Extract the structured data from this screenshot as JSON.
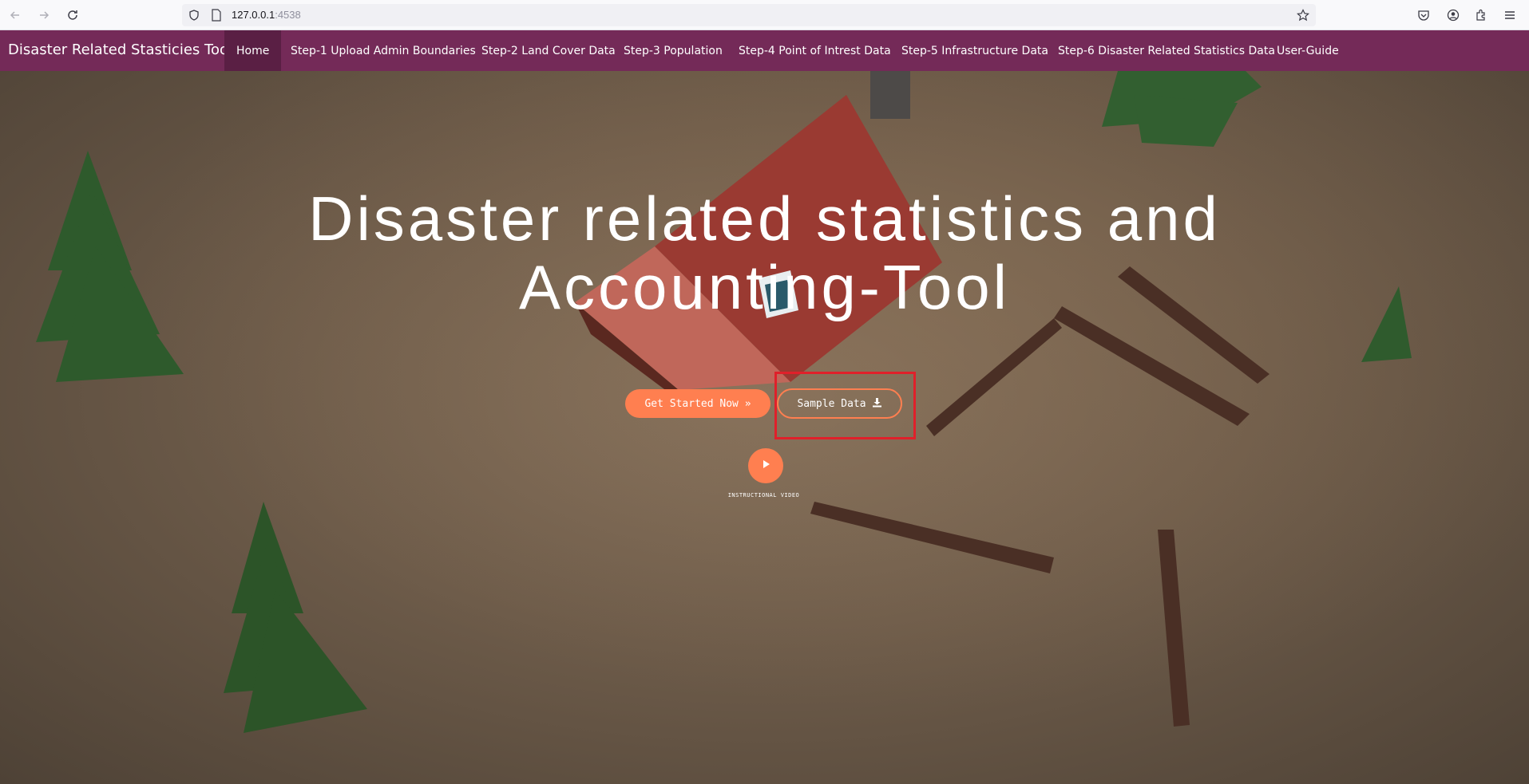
{
  "browser": {
    "url_host": "127.0.0.1",
    "url_port": ":4538"
  },
  "navbar": {
    "brand": "Disaster Related Stasticies Tool",
    "items": [
      {
        "label": "Home",
        "active": true
      },
      {
        "label": "Step-1 Upload Admin Boundaries"
      },
      {
        "label": "Step-2 Land Cover Data"
      },
      {
        "label": "Step-3 Population"
      },
      {
        "label": "Step-4 Point of Intrest Data"
      },
      {
        "label": "Step-5 Infrastructure Data"
      },
      {
        "label": "Step-6 Disaster Related Statistics Data"
      },
      {
        "label": "User-Guide"
      }
    ]
  },
  "hero": {
    "title_line1": "Disaster related statistics and",
    "title_line2": "Accounting-Tool",
    "get_started_label": "Get Started Now »",
    "sample_data_label": "Sample Data",
    "video_label": "INSTRUCTIONAL VIDEO"
  },
  "colors": {
    "navbar": "#742a58",
    "accent": "#ff7f50",
    "highlight": "#e0202a"
  },
  "icons": [
    "back-icon",
    "forward-icon",
    "reload-icon",
    "shield-icon",
    "page-icon",
    "star-icon",
    "pocket-icon",
    "account-icon",
    "extensions-icon",
    "menu-icon",
    "download-icon",
    "play-icon"
  ]
}
